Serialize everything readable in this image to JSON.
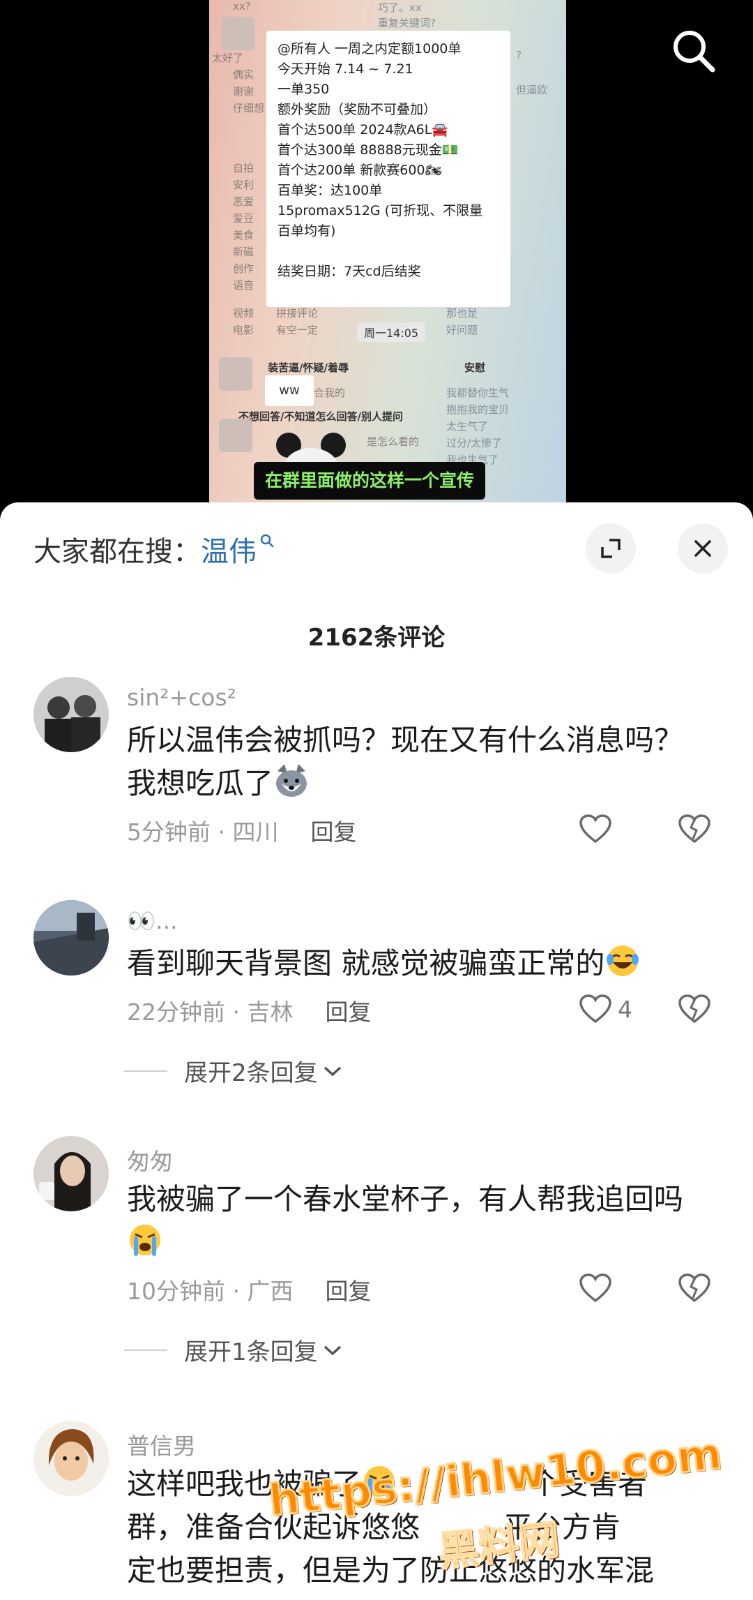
{
  "video": {
    "notice_lines": [
      "@所有人 一周之内定额1000单",
      "今天开始 7.14 ~ 7.21",
      "一单350",
      "",
      "额外奖励（奖励不可叠加）",
      "首个达500单  2024款A6L🚘",
      "首个达300单 88888元现金💵",
      "首个达200单 新款赛600🏍",
      "百单奖：达100单",
      "15promax512G (可折现、不限量",
      "百单均有)",
      "",
      "结奖日期：7天cd后结奖"
    ],
    "time_chip": "周一14:05",
    "bubble": "ww",
    "heading_left_1": "装苦逼/怀疑/着辱",
    "heading_left_2": "不想回答/不知道怎么回答/别人提问",
    "heading_right": "安慰",
    "bg_left": [
      "xx?",
      "太好了",
      "偶实",
      "谢谢",
      "仔细想",
      "自拍",
      "安利",
      "恶爱",
      "爱豆",
      "美食",
      "新磁",
      "创作",
      "语音",
      "视频",
      "电影"
    ],
    "bg_right": [
      "巧了。xx",
      "重复关键词?",
      "?",
      "但逼欧",
      "那也是",
      "好问题",
      "我都替你生气",
      "抱抱我的宝贝",
      "太生气了",
      "过分/太惨了",
      "我也生气了"
    ],
    "bg_mid": [
      "拼接评论",
      "有空一定",
      "合我的",
      "是怎么看的"
    ],
    "subtitle": "在群里面做的这样一个宣传",
    "search_icon": "search-icon"
  },
  "sheet": {
    "search_prefix": "大家都在搜：",
    "search_keyword": "温伟",
    "comment_count": "2162条评论",
    "comments": [
      {
        "name": "sin²+cos²",
        "text": "所以温伟会被抓吗？现在又有什么消息吗？我想吃瓜了",
        "emoji": "husky-face-emoji",
        "meta": "5分钟前 · 四川",
        "reply": "回复",
        "likes": ""
      },
      {
        "name": "👀...",
        "text": "看到聊天背景图 就感觉被骗蛮正常的",
        "emoji": "laughing-tears-emoji",
        "meta": "22分钟前 · 吉林",
        "reply": "回复",
        "likes": "4",
        "expand": "展开2条回复"
      },
      {
        "name": "匆匆",
        "text": "我被骗了一个春水堂杯子，有人帮我追回吗",
        "emoji": "crying-face-emoji",
        "meta": "10分钟前 · 广西",
        "reply": "回复",
        "likes": "",
        "expand": "展开1条回复"
      },
      {
        "name": "普信男",
        "text_1": "这样吧我也被骗了",
        "text_1b": "个受害者",
        "text_2": "群，准备合伙起诉悠悠",
        "text_2b": "平台方肯",
        "text_3": "定也要担责，但是为了防止悠悠的水军混"
      }
    ],
    "watermark_url": "https://ihlw10.com",
    "watermark_name": "黑料网"
  },
  "colors": {
    "accent": "#2f6fb2",
    "subtitle": "#8ef06a",
    "watermark": "#ff8a00"
  }
}
